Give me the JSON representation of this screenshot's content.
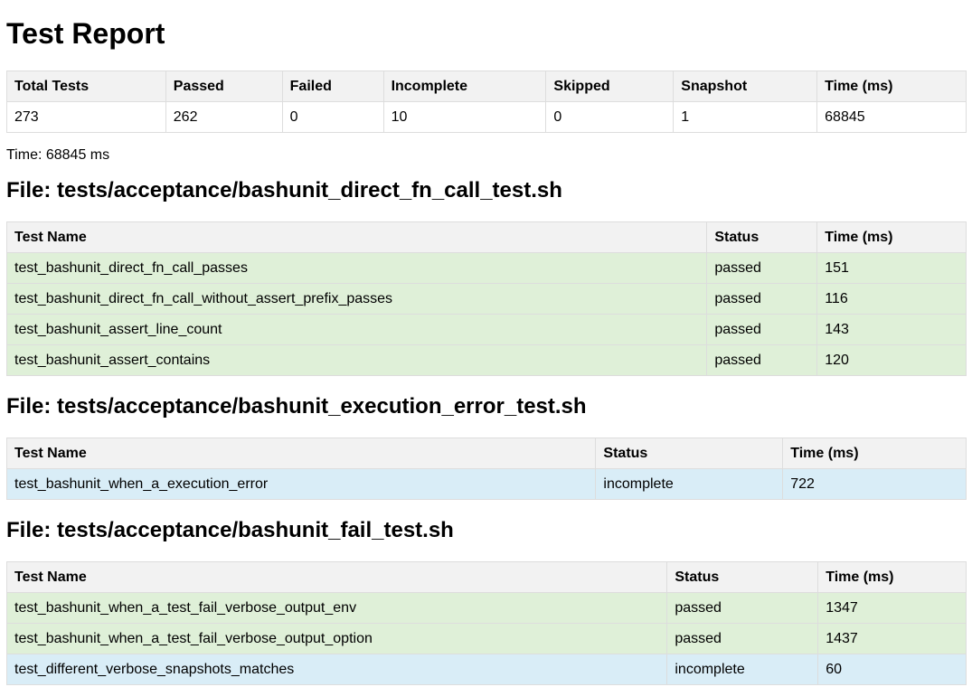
{
  "page": {
    "title": "Test Report",
    "time_label": "Time: 68845 ms"
  },
  "summary": {
    "headers": [
      "Total Tests",
      "Passed",
      "Failed",
      "Incomplete",
      "Skipped",
      "Snapshot",
      "Time (ms)"
    ],
    "values": [
      "273",
      "262",
      "0",
      "10",
      "0",
      "1",
      "68845"
    ]
  },
  "files": [
    {
      "title": "File: tests/acceptance/bashunit_direct_fn_call_test.sh",
      "headers": [
        "Test Name",
        "Status",
        "Time (ms)"
      ],
      "rows": [
        {
          "name": "test_bashunit_direct_fn_call_passes",
          "status": "passed",
          "time": "151"
        },
        {
          "name": "test_bashunit_direct_fn_call_without_assert_prefix_passes",
          "status": "passed",
          "time": "116"
        },
        {
          "name": "test_bashunit_assert_line_count",
          "status": "passed",
          "time": "143"
        },
        {
          "name": "test_bashunit_assert_contains",
          "status": "passed",
          "time": "120"
        }
      ]
    },
    {
      "title": "File: tests/acceptance/bashunit_execution_error_test.sh",
      "headers": [
        "Test Name",
        "Status",
        "Time (ms)"
      ],
      "rows": [
        {
          "name": "test_bashunit_when_a_execution_error",
          "status": "incomplete",
          "time": "722"
        }
      ]
    },
    {
      "title": "File: tests/acceptance/bashunit_fail_test.sh",
      "headers": [
        "Test Name",
        "Status",
        "Time (ms)"
      ],
      "rows": [
        {
          "name": "test_bashunit_when_a_test_fail_verbose_output_env",
          "status": "passed",
          "time": "1347"
        },
        {
          "name": "test_bashunit_when_a_test_fail_verbose_output_option",
          "status": "passed",
          "time": "1437"
        },
        {
          "name": "test_different_verbose_snapshots_matches",
          "status": "incomplete",
          "time": "60"
        }
      ]
    }
  ],
  "colors": {
    "passed_row": "#dff0d8",
    "incomplete_row": "#d9edf7",
    "header_bg": "#f2f2f2",
    "border": "#dddddd"
  }
}
